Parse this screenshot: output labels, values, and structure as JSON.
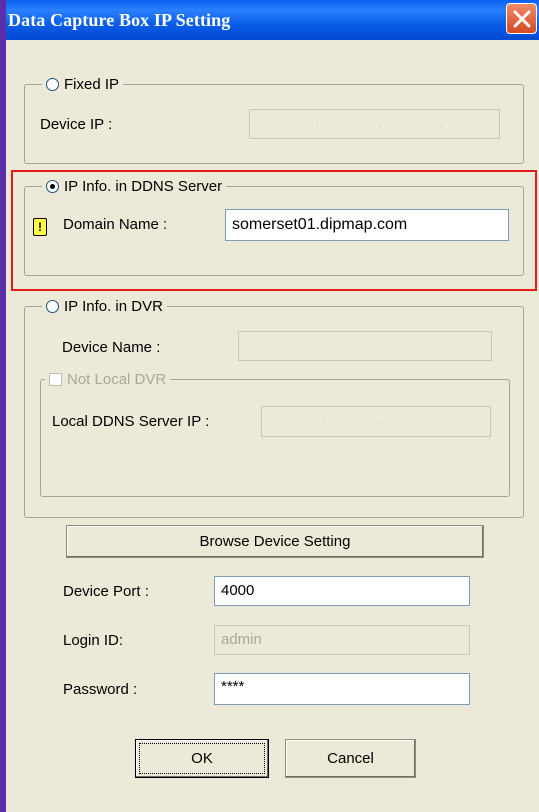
{
  "window": {
    "title": "Data Capture Box IP Setting"
  },
  "fixed_ip": {
    "legend": "Fixed IP",
    "device_ip_label": "Device IP :",
    "selected": false
  },
  "ddns": {
    "legend": "IP Info. in DDNS Server",
    "domain_label": "Domain Name :",
    "domain_value": "somerset01.dipmap.com",
    "selected": true,
    "warning_icon": "exclamation-icon"
  },
  "dvr": {
    "legend": "IP Info. in DVR",
    "device_name_label": "Device Name :",
    "not_local_label": "Not Local DVR",
    "local_ddns_label": "Local DDNS Server IP :",
    "selected": false
  },
  "browse_button": "Browse Device Setting",
  "port": {
    "label": "Device Port :",
    "value": "4000"
  },
  "login": {
    "label": "Login ID:",
    "value": "admin"
  },
  "password": {
    "label": "Password :",
    "value": "****"
  },
  "buttons": {
    "ok": "OK",
    "cancel": "Cancel"
  },
  "colors": {
    "title_bar": "#0a5ee8",
    "dialog_bg": "#ece9d8",
    "highlight": "#e41b1b"
  }
}
